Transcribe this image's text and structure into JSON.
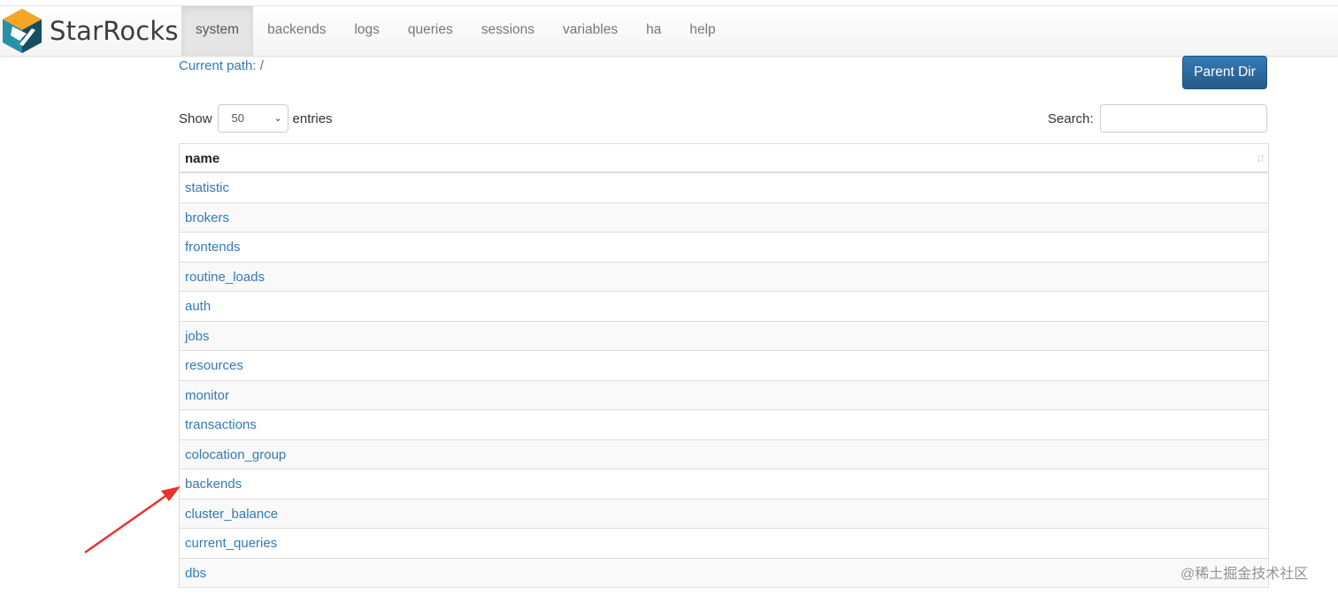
{
  "brand": {
    "name": "StarRocks"
  },
  "nav": {
    "items": [
      "system",
      "backends",
      "logs",
      "queries",
      "sessions",
      "variables",
      "ha",
      "help"
    ],
    "active": "system"
  },
  "current_path": "Current path: /",
  "parent_dir_label": "Parent Dir",
  "length": {
    "show_label": "Show",
    "value": "50",
    "entries_label": "entries"
  },
  "search": {
    "label": "Search:",
    "value": ""
  },
  "table": {
    "header": "name",
    "rows": [
      "statistic",
      "brokers",
      "frontends",
      "routine_loads",
      "auth",
      "jobs",
      "resources",
      "monitor",
      "transactions",
      "colocation_group",
      "backends",
      "cluster_balance",
      "current_queries",
      "dbs"
    ]
  },
  "watermark": "@稀土掘金技术社区",
  "colors": {
    "link": "#337ab7",
    "button": "#2d6ca2",
    "arrow": "#e8322c"
  }
}
